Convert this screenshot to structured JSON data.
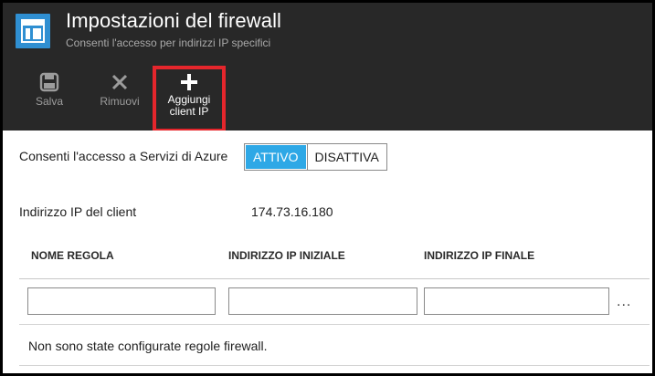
{
  "header": {
    "title": "Impostazioni del firewall",
    "subtitle": "Consenti l'accesso per indirizzi IP specifici",
    "icon": "firewall-blade-icon",
    "accent": "#2f8fd2"
  },
  "commands": {
    "save": {
      "label": "Salva",
      "icon": "save-icon"
    },
    "remove": {
      "label": "Rimuovi",
      "icon": "close-icon"
    },
    "add_client_ip": {
      "label_line1": "Aggiungi",
      "label_line2": "client IP",
      "icon": "plus-icon",
      "highlight": "#e5262c"
    }
  },
  "azure_access": {
    "label": "Consenti l'accesso a Servizi di Azure",
    "on_label": "ATTIVO",
    "off_label": "DISATTIVA",
    "selected": "ATTIVO",
    "on_color": "#2ea8e6"
  },
  "client_ip": {
    "label": "Indirizzo IP del client",
    "value": "174.73.16.180"
  },
  "rules_table": {
    "columns": [
      "NOME REGOLA",
      "INDIRIZZO IP INIZIALE",
      "INDIRIZZO IP FINALE"
    ],
    "new_row": {
      "name": "",
      "start_ip": "",
      "end_ip": ""
    },
    "more_label": "...",
    "empty_message": "Non sono state configurate regole firewall."
  }
}
